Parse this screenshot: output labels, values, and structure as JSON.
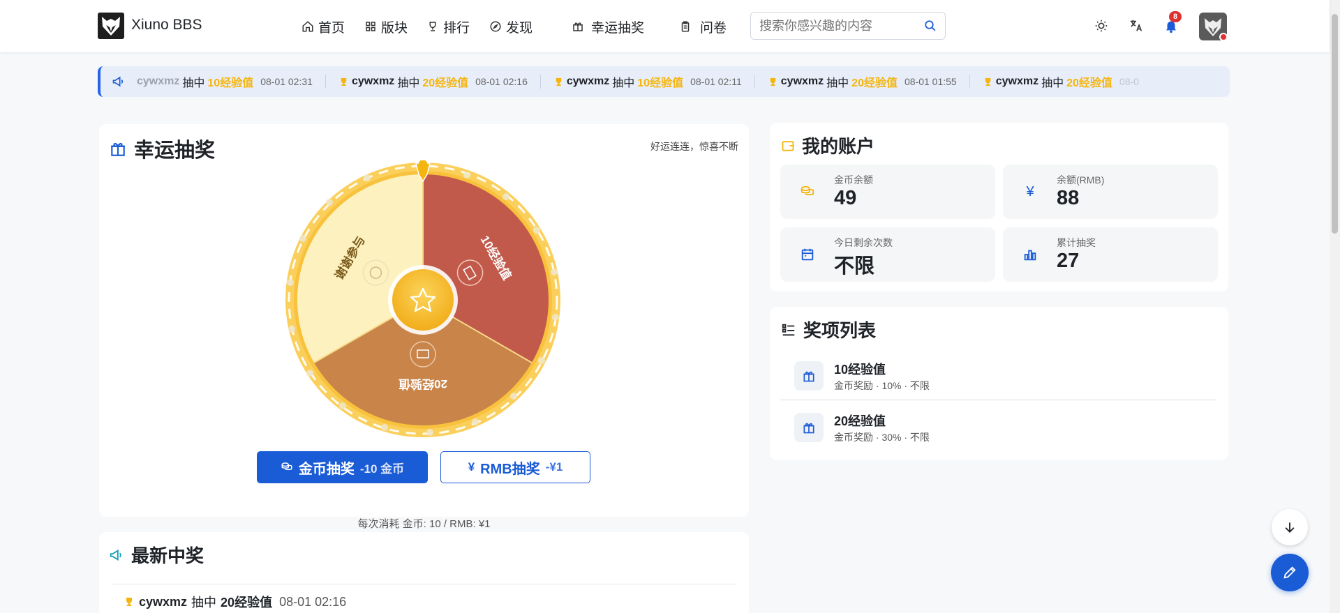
{
  "header": {
    "brand": "Xiuno BBS",
    "nav": [
      {
        "label": "首页",
        "icon": "home-icon"
      },
      {
        "label": "版块",
        "icon": "grid-icon"
      },
      {
        "label": "排行",
        "icon": "trophy-icon"
      },
      {
        "label": "发现",
        "icon": "compass-icon"
      },
      {
        "label": "幸运抽奖",
        "icon": "gift-icon"
      },
      {
        "label": "问卷",
        "icon": "clipboard-icon"
      }
    ],
    "search_placeholder": "搜索你感兴趣的内容",
    "notification_count": "8"
  },
  "ticker": {
    "items": [
      {
        "user": "cywxmz",
        "verb": "抽中",
        "prize": "10经验值",
        "time": "08-01 02:31"
      },
      {
        "user": "cywxmz",
        "verb": "抽中",
        "prize": "20经验值",
        "time": "08-01 02:16"
      },
      {
        "user": "cywxmz",
        "verb": "抽中",
        "prize": "10经验值",
        "time": "08-01 02:11"
      },
      {
        "user": "cywxmz",
        "verb": "抽中",
        "prize": "20经验值",
        "time": "08-01 01:55"
      },
      {
        "user": "cywxmz",
        "verb": "抽中",
        "prize": "20经验值",
        "time": "08-0"
      }
    ]
  },
  "lottery": {
    "title": "幸运抽奖",
    "subtitle": "好运连连，惊喜不断",
    "wheel_segments": [
      {
        "label": "10经验值",
        "color": "#c25a4c"
      },
      {
        "label": "20经验值",
        "color": "#c9844a"
      },
      {
        "label": "谢谢参与",
        "color": "#fdf2bf"
      }
    ],
    "coin_button": {
      "label": "金币抽奖",
      "cost": "-10 金币"
    },
    "rmb_button": {
      "label": "RMB抽奖",
      "cost": "-¥1"
    },
    "cost_note": "每次消耗 金币: 10 / RMB: ¥1"
  },
  "account": {
    "title": "我的账户",
    "stats": [
      {
        "label": "金币余额",
        "value": "49",
        "icon": "coins-icon"
      },
      {
        "label": "余额(RMB)",
        "value": "88",
        "icon": "yen-icon"
      },
      {
        "label": "今日剩余次数",
        "value": "不限",
        "icon": "calendar-icon"
      },
      {
        "label": "累计抽奖",
        "value": "27",
        "icon": "bar-chart-icon"
      }
    ]
  },
  "prizes": {
    "title": "奖项列表",
    "items": [
      {
        "name": "10经验值",
        "desc": "金币奖励 · 10% · 不限"
      },
      {
        "name": "20经验值",
        "desc": "金币奖励 · 30% · 不限"
      }
    ]
  },
  "recent": {
    "title": "最新中奖",
    "items": [
      {
        "user": "cywxmz",
        "verb": "抽中",
        "prize": "20经验值",
        "time": "08-01 02:16"
      }
    ]
  },
  "colors": {
    "accent": "#1a5bd6",
    "gold": "#f5b50f",
    "wheel_rim": "#f9c23c"
  }
}
